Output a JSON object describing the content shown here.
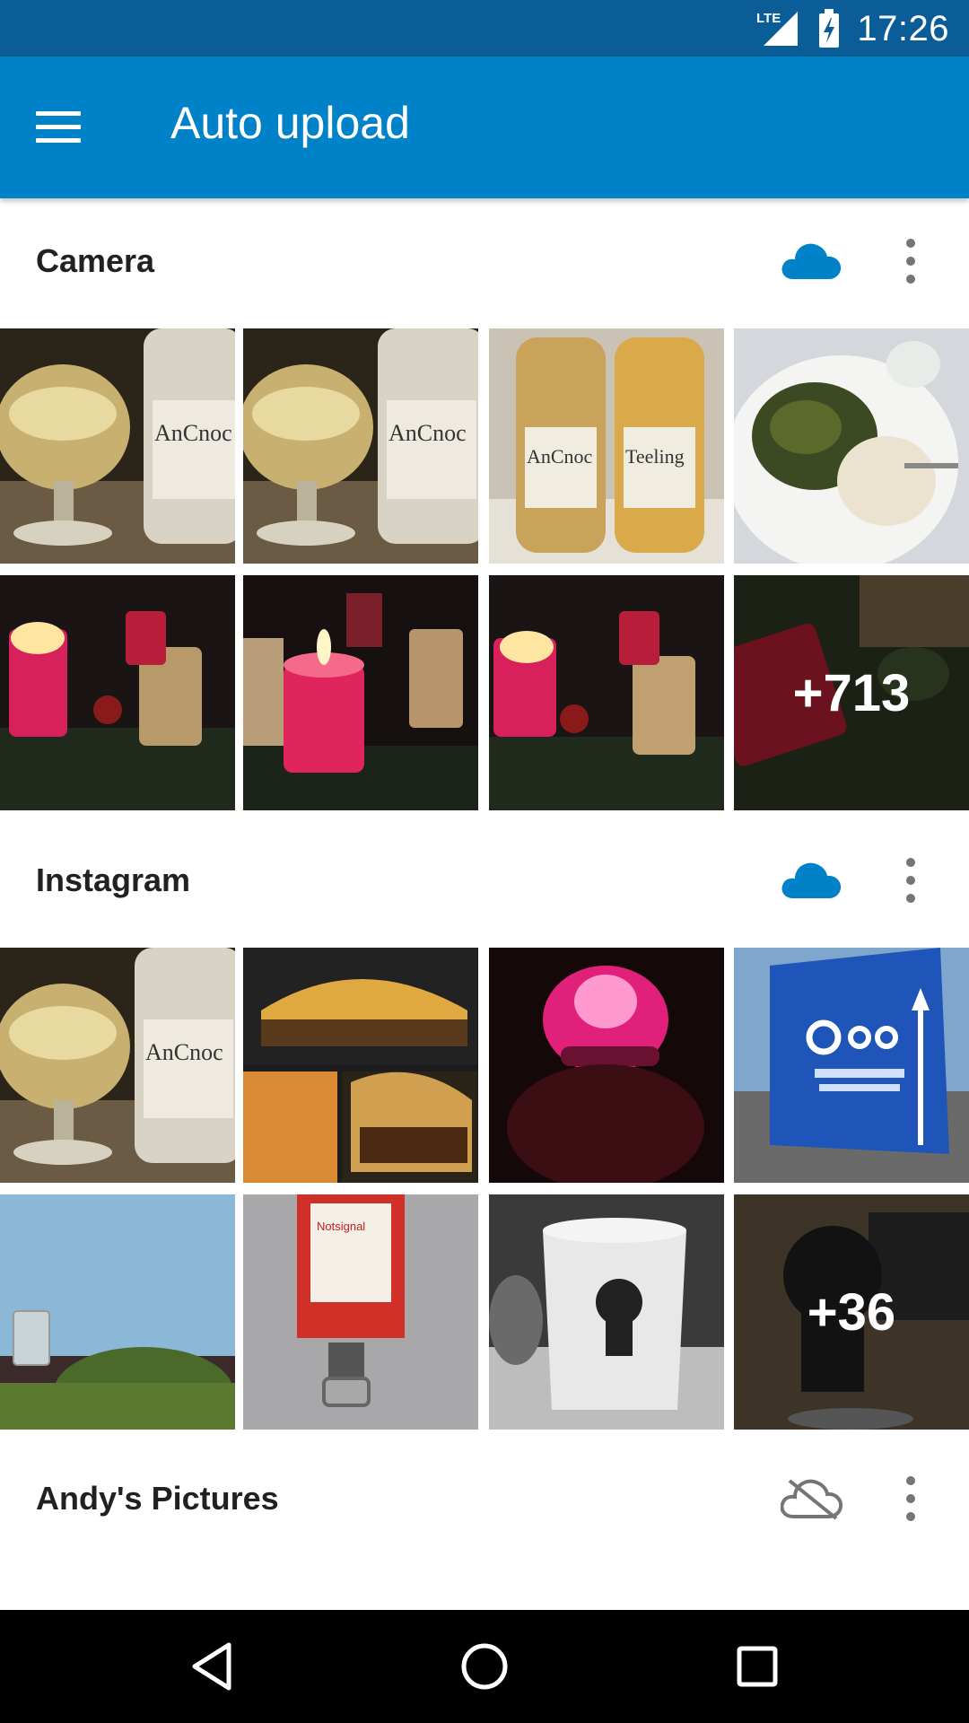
{
  "status_bar": {
    "network": "LTE",
    "time": "17:26"
  },
  "app_bar": {
    "title": "Auto upload"
  },
  "colors": {
    "accent": "#0082c9",
    "status_bar": "#0a5d96",
    "cloud_enabled": "#0082c9",
    "cloud_disabled": "#757575"
  },
  "folders": [
    {
      "name": "Camera",
      "upload_enabled": true,
      "more_count": "+713"
    },
    {
      "name": "Instagram",
      "upload_enabled": true,
      "more_count": "+36"
    },
    {
      "name": "Andy's Pictures",
      "upload_enabled": false
    }
  ],
  "thumbnails": {
    "camera": [
      "whisky-glass-ancnoc",
      "whisky-glass-ancnoc",
      "whisky-sample-bottles",
      "spinach-rice-plate",
      "advent-candles",
      "advent-candle-lit",
      "advent-candles",
      "advent-wreath"
    ],
    "instagram": [
      "whisky-glass-ancnoc",
      "casserole-collage",
      "pink-lit-face",
      "nextcloud-conference-sign",
      "glass-on-bench",
      "emergency-switch-box",
      "octocat-mug",
      "octocat-figure"
    ]
  },
  "icons": {
    "menu": "hamburger-icon",
    "cloud_on": "cloud-icon",
    "cloud_off": "cloud-off-icon",
    "more": "more-vertical-icon",
    "back": "back-triangle-icon",
    "home": "home-circle-icon",
    "recents": "recents-square-icon"
  }
}
